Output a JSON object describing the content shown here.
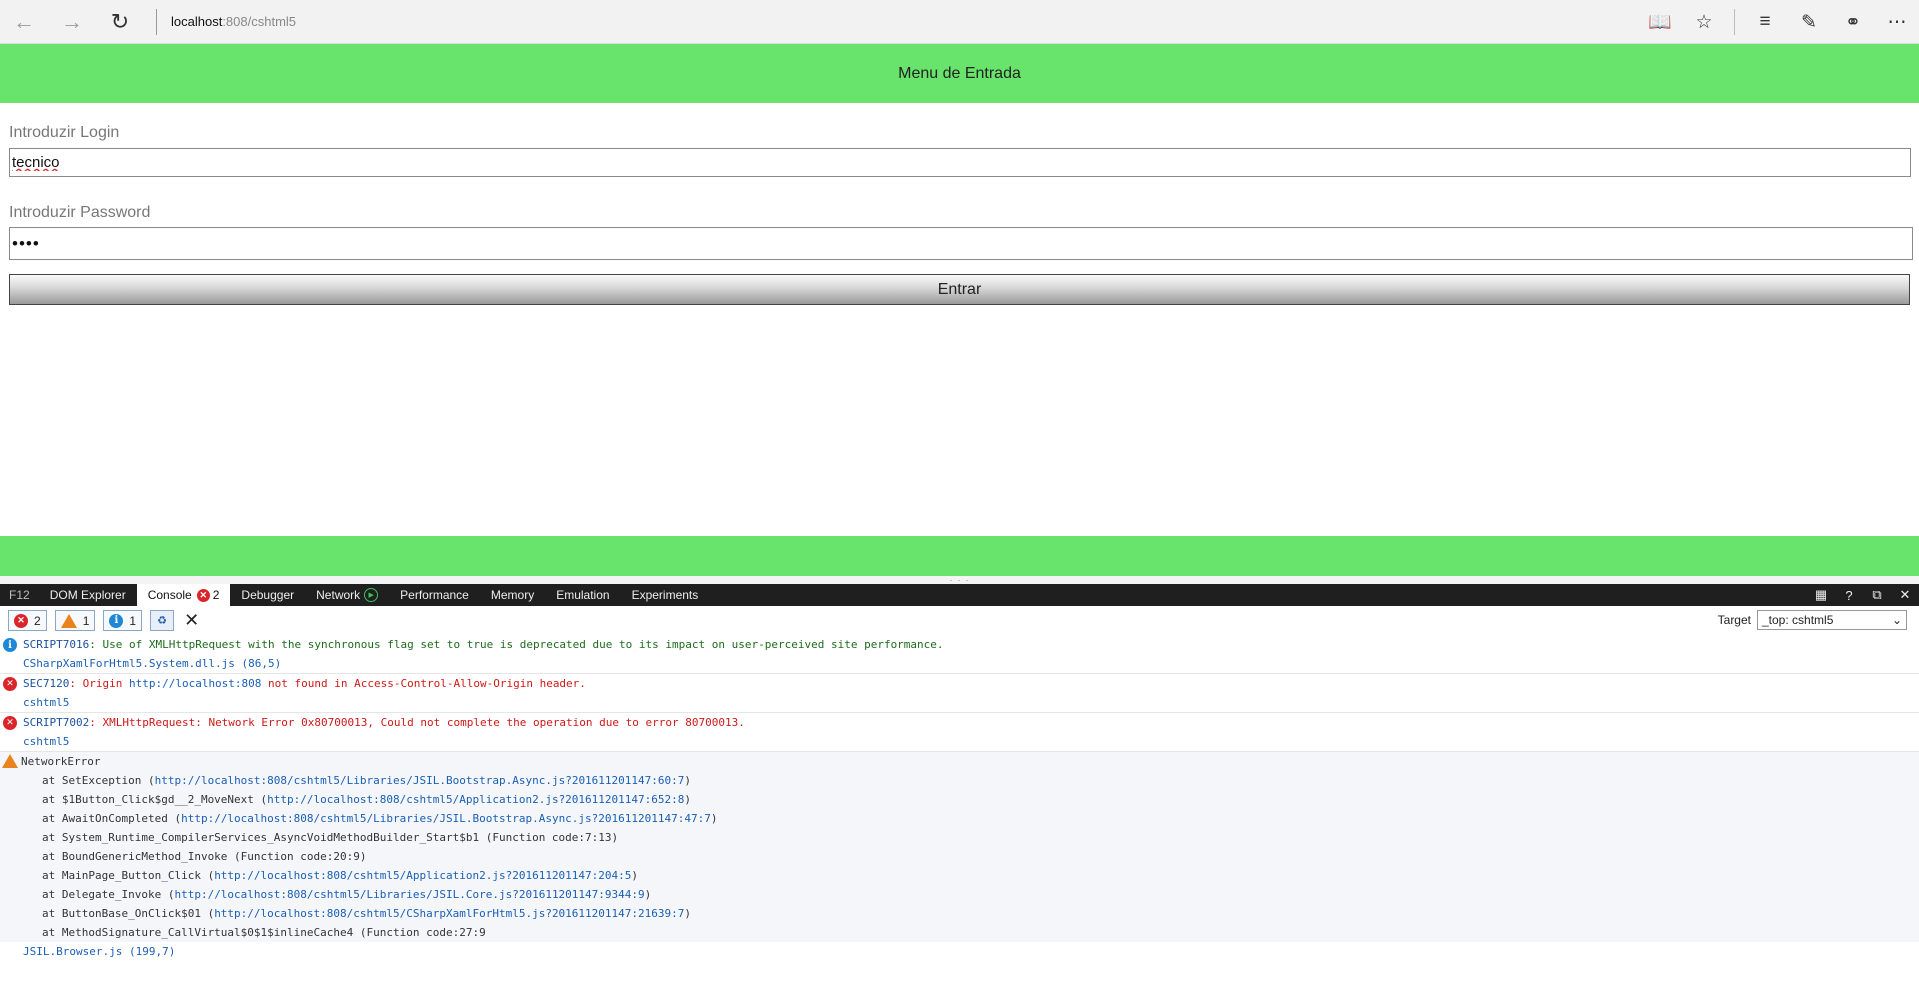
{
  "browser": {
    "url_host": "localhost",
    "url_path": ":808/cshtml5"
  },
  "page": {
    "header_title": "Menu de Entrada",
    "login_label": "Introduzir Login",
    "login_value": "tecnico",
    "password_label": "Introduzir Password",
    "password_value": "••••",
    "enter_button": "Entrar",
    "accent_color": "#68e36b"
  },
  "devtools": {
    "f12": "F12",
    "tabs": [
      "DOM Explorer",
      "Console",
      "Debugger",
      "Network",
      "Performance",
      "Memory",
      "Emulation",
      "Experiments"
    ],
    "console_error_badge": "2",
    "filters": {
      "errors": "2",
      "warnings": "1",
      "info": "1"
    },
    "target_label": "Target",
    "target_value": "_top: cshtml5"
  },
  "console": {
    "info": {
      "code": "SCRIPT7016",
      "message": ": Use of XMLHttpRequest with the synchronous flag set to true is deprecated due to its impact on user-perceived site performance.",
      "source": "CSharpXamlForHtml5.System.dll.js (86,5)"
    },
    "sec_error": {
      "code": "SEC7120",
      "message_pre": ": Origin ",
      "origin": "http://localhost:808",
      "message_post": " not found in Access-Control-Allow-Origin header.",
      "source": "cshtml5"
    },
    "net_error": {
      "code": "SCRIPT7002",
      "message": ": XMLHttpRequest: Network Error 0x80700013, Could not complete the operation due to error 80700013.",
      "source": "cshtml5"
    },
    "warning": {
      "title": "NetworkError",
      "stack": [
        {
          "pre": "at SetException (",
          "link": "http://localhost:808/cshtml5/Libraries/JSIL.Bootstrap.Async.js?201611201147:60:7",
          "post": ")"
        },
        {
          "pre": "at $1Button_Click$gd__2_MoveNext (",
          "link": "http://localhost:808/cshtml5/Application2.js?201611201147:652:8",
          "post": ")"
        },
        {
          "pre": "at AwaitOnCompleted (",
          "link": "http://localhost:808/cshtml5/Libraries/JSIL.Bootstrap.Async.js?201611201147:47:7",
          "post": ")"
        },
        {
          "pre": "at System_Runtime_CompilerServices_AsyncVoidMethodBuilder_Start$b1 (Function code:7:13)",
          "link": "",
          "post": ""
        },
        {
          "pre": "at BoundGenericMethod_Invoke (Function code:20:9)",
          "link": "",
          "post": ""
        },
        {
          "pre": "at MainPage_Button_Click (",
          "link": "http://localhost:808/cshtml5/Application2.js?201611201147:204:5",
          "post": ")"
        },
        {
          "pre": "at Delegate_Invoke (",
          "link": "http://localhost:808/cshtml5/Libraries/JSIL.Core.js?201611201147:9344:9",
          "post": ")"
        },
        {
          "pre": "at ButtonBase_OnClick$01 (",
          "link": "http://localhost:808/cshtml5/CSharpXamlForHtml5.js?201611201147:21639:7",
          "post": ")"
        },
        {
          "pre": "at MethodSignature_CallVirtual$0$1$inlineCache4 (Function code:27:9",
          "link": "",
          "post": ""
        }
      ],
      "source": "JSIL.Browser.js (199,7)"
    }
  }
}
